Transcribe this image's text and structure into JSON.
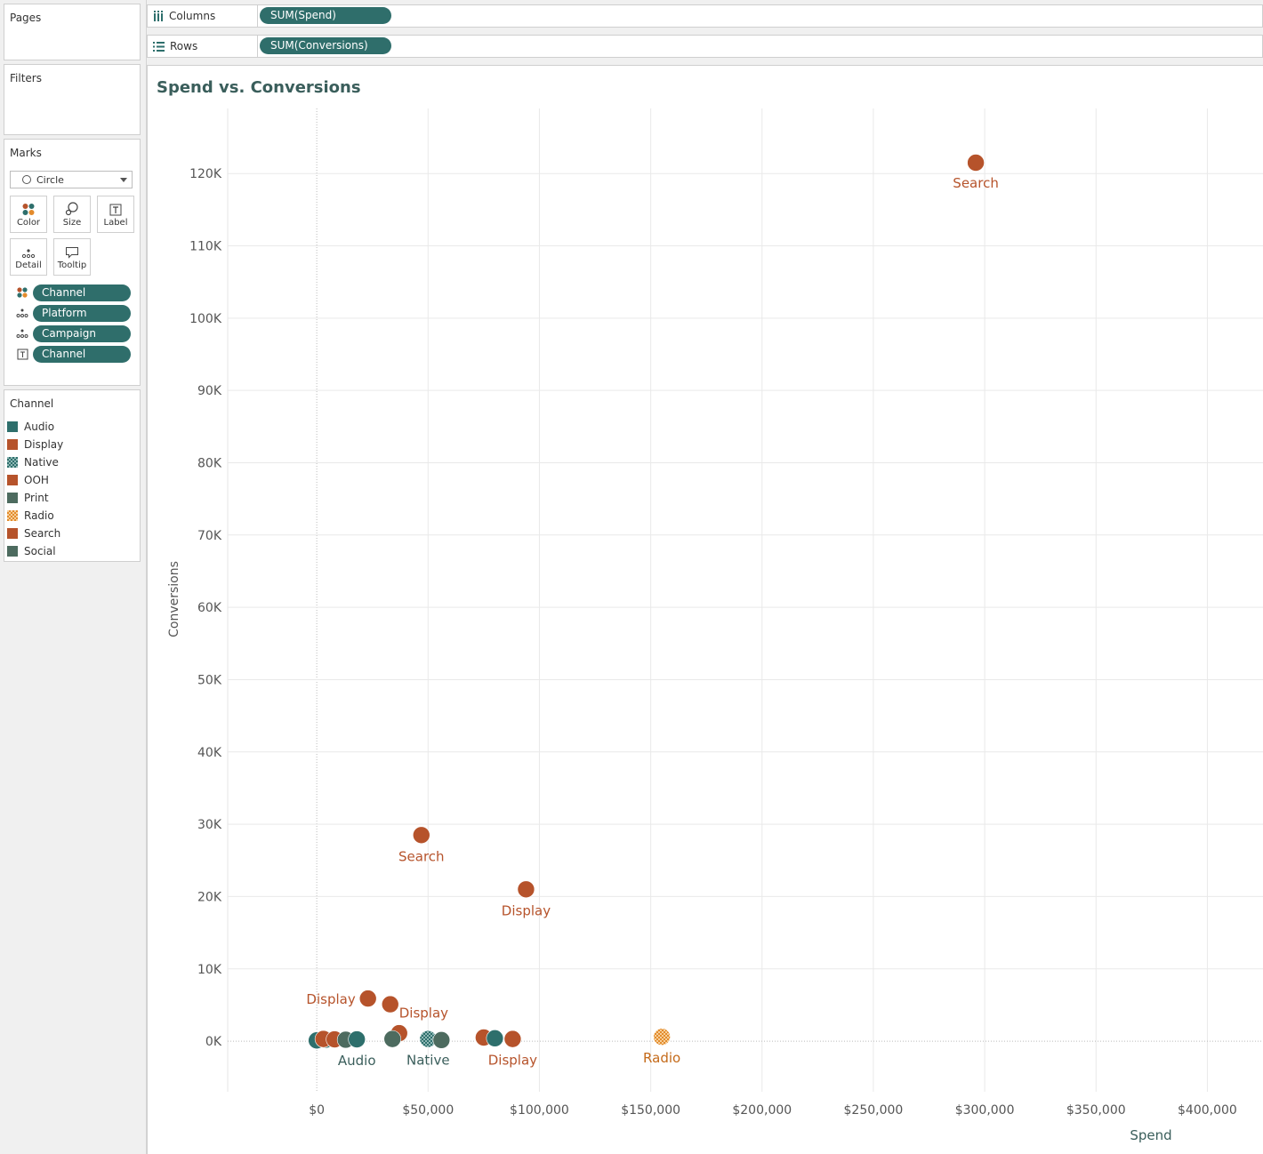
{
  "panels": {
    "pages": {
      "title": "Pages"
    },
    "filters": {
      "title": "Filters"
    },
    "marks": {
      "title": "Marks",
      "mark_type": "Circle",
      "buttons": [
        {
          "label": "Color",
          "icon": "color-icon"
        },
        {
          "label": "Size",
          "icon": "size-icon"
        },
        {
          "label": "Label",
          "icon": "label-icon"
        },
        {
          "label": "Detail",
          "icon": "detail-icon"
        },
        {
          "label": "Tooltip",
          "icon": "tooltip-icon"
        }
      ],
      "fields": [
        {
          "label": "Channel",
          "role": "color"
        },
        {
          "label": "Platform",
          "role": "detail"
        },
        {
          "label": "Campaign",
          "role": "detail"
        },
        {
          "label": "Channel",
          "role": "label"
        }
      ]
    },
    "legend": {
      "title": "Channel",
      "items": [
        {
          "label": "Audio",
          "color": "#2e6f6c",
          "pattern": "solid"
        },
        {
          "label": "Display",
          "color": "#b6532b",
          "pattern": "solid"
        },
        {
          "label": "Native",
          "color": "#2e6f6c",
          "pattern": "checker"
        },
        {
          "label": "OOH",
          "color": "#b6532b",
          "pattern": "solid"
        },
        {
          "label": "Print",
          "color": "#4d6b5f",
          "pattern": "solid"
        },
        {
          "label": "Radio",
          "color": "#e38b2c",
          "pattern": "checker"
        },
        {
          "label": "Search",
          "color": "#b6532b",
          "pattern": "solid"
        },
        {
          "label": "Social",
          "color": "#4d6b5f",
          "pattern": "solid"
        }
      ]
    }
  },
  "shelves": {
    "columns": {
      "label": "Columns",
      "pill": "SUM(Spend)"
    },
    "rows": {
      "label": "Rows",
      "pill": "SUM(Conversions)"
    }
  },
  "chart_data": {
    "type": "scatter",
    "title": "Spend vs. Conversions",
    "xlabel": "Spend",
    "ylabel": "Conversions",
    "xlim": [
      -40000,
      425000
    ],
    "ylim": [
      -7000,
      129000
    ],
    "x_ticks": [
      0,
      50000,
      100000,
      150000,
      200000,
      250000,
      300000,
      350000,
      400000
    ],
    "x_tick_labels": [
      "$0",
      "$50,000",
      "$100,000",
      "$150,000",
      "$200,000",
      "$250,000",
      "$300,000",
      "$350,000",
      "$400,000"
    ],
    "y_ticks": [
      0,
      10000,
      20000,
      30000,
      40000,
      50000,
      60000,
      70000,
      80000,
      90000,
      100000,
      110000,
      120000
    ],
    "y_tick_labels": [
      "0K",
      "10K",
      "20K",
      "30K",
      "40K",
      "50K",
      "60K",
      "70K",
      "80K",
      "90K",
      "100K",
      "110K",
      "120K"
    ],
    "grid": true,
    "points": [
      {
        "channel": "Search",
        "x": 296000,
        "y": 121500,
        "label": "Search"
      },
      {
        "channel": "Search",
        "x": 47000,
        "y": 28500,
        "label": "Search"
      },
      {
        "channel": "Display",
        "x": 94000,
        "y": 21000,
        "label": "Display"
      },
      {
        "channel": "Display",
        "x": 23000,
        "y": 5900,
        "label": "Display"
      },
      {
        "channel": "Display",
        "x": 33000,
        "y": 5100,
        "label": "Display"
      },
      {
        "channel": "OOH",
        "x": 37000,
        "y": 1100,
        "label": ""
      },
      {
        "channel": "Audio",
        "x": 0,
        "y": 100,
        "label": ""
      },
      {
        "channel": "Audio",
        "x": 4000,
        "y": 200,
        "label": ""
      },
      {
        "channel": "Display",
        "x": 3000,
        "y": 300,
        "label": ""
      },
      {
        "channel": "Display",
        "x": 8000,
        "y": 250,
        "label": ""
      },
      {
        "channel": "Print",
        "x": 13000,
        "y": 200,
        "label": ""
      },
      {
        "channel": "Audio",
        "x": 18000,
        "y": 250,
        "label": "Audio"
      },
      {
        "channel": "Print",
        "x": 34000,
        "y": 300,
        "label": ""
      },
      {
        "channel": "Native",
        "x": 50000,
        "y": 300,
        "label": "Native"
      },
      {
        "channel": "Print",
        "x": 56000,
        "y": 150,
        "label": ""
      },
      {
        "channel": "OOH",
        "x": 75000,
        "y": 500,
        "label": ""
      },
      {
        "channel": "Audio",
        "x": 80000,
        "y": 400,
        "label": ""
      },
      {
        "channel": "Display",
        "x": 88000,
        "y": 300,
        "label": "Display"
      },
      {
        "channel": "Radio",
        "x": 155000,
        "y": 600,
        "label": "Radio"
      }
    ]
  }
}
